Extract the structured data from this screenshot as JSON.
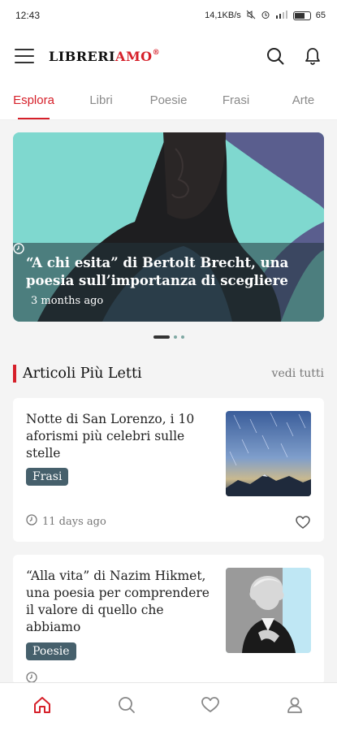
{
  "status_bar": {
    "time": "12:43",
    "network_speed": "14,1KB/s",
    "battery": "65"
  },
  "header": {
    "logo_main": "LIBRERI",
    "logo_accent": "AMO",
    "logo_mark": "®"
  },
  "tabs": [
    {
      "label": "Esplora",
      "active": true
    },
    {
      "label": "Libri",
      "active": false
    },
    {
      "label": "Poesie",
      "active": false
    },
    {
      "label": "Frasi",
      "active": false
    },
    {
      "label": "Arte",
      "active": false
    }
  ],
  "hero": {
    "title": "“A chi esita” di Bertolt Brecht, una poesia sull’importanza di scegliere",
    "time_ago": "3 months ago"
  },
  "carousel": {
    "count": 3,
    "active_index": 0
  },
  "section": {
    "title": "Articoli Più Letti",
    "see_all": "vedi tutti"
  },
  "articles": [
    {
      "title": "Notte di San Lorenzo, i 10 aforismi più celebri sulle stelle",
      "tag": "Frasi",
      "time_ago": "11 days ago"
    },
    {
      "title": "“Alla vita” di Nazim Hikmet, una poesia per comprendere il valore di quello che abbiamo",
      "tag": "Poesie",
      "time_ago": ""
    }
  ],
  "bottom_nav": [
    {
      "icon": "home-icon",
      "active": true
    },
    {
      "icon": "search-icon",
      "active": false
    },
    {
      "icon": "heart-icon",
      "active": false
    },
    {
      "icon": "user-icon",
      "active": false
    }
  ],
  "colors": {
    "accent": "#d6202a",
    "tag_bg": "#46606c",
    "hero_teal": "#7fd8cf"
  }
}
